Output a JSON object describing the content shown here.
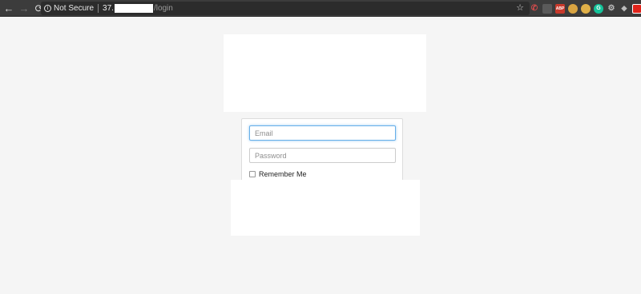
{
  "browser": {
    "security_label": "Not Secure",
    "url_host": "37.",
    "url_path": "/login",
    "nav": {
      "back": "←",
      "forward": "→",
      "reload": "⟳"
    },
    "extensions": [
      "phone-icon",
      "extension-icon",
      "adblock-plus-icon",
      "cookie-icon",
      "cookie-icon",
      "grammarly-icon",
      "gear-icon",
      "puzzle-icon",
      "red-extension-icon"
    ]
  },
  "login": {
    "email_placeholder": "Email",
    "password_placeholder": "Password",
    "remember_label": "Remember Me"
  },
  "colors": {
    "page_bg": "#f5f5f5",
    "chrome_bg": "#3c3c3c",
    "focus_ring": "#66afe9"
  }
}
